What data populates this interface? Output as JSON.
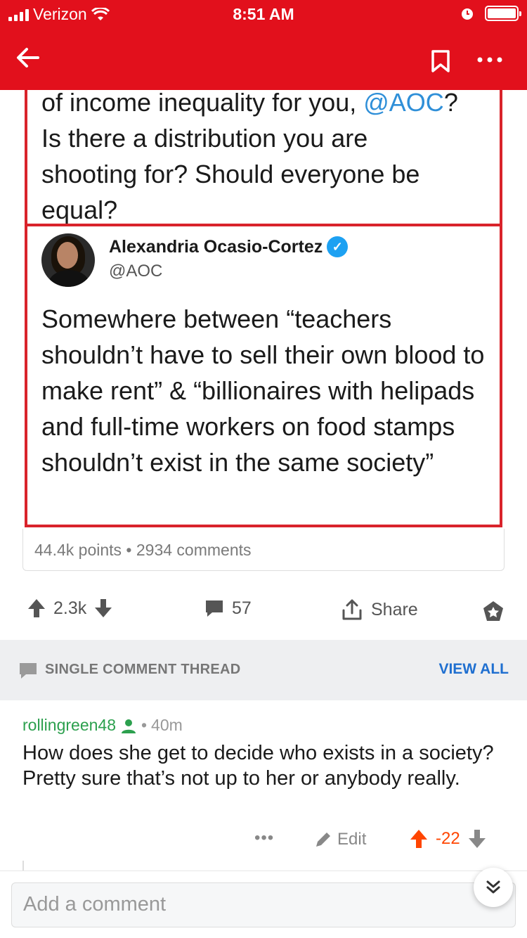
{
  "status_bar": {
    "carrier": "Verizon",
    "time": "8:51 AM"
  },
  "colors": {
    "header": "#e2101c",
    "link": "#2f8fd8",
    "author": "#2ca04e",
    "score": "#ff4500",
    "view_all": "#1f6fd0"
  },
  "post": {
    "tweet_top_lines": [
      "of income inequality for you, ",
      "@AOC",
      "?",
      "Is there a distribution you are",
      "shooting for? Should everyone be",
      "equal?"
    ],
    "tweet_name": "Alexandria Ocasio-Cortez",
    "tweet_handle": "@AOC",
    "tweet_body": "Somewhere between “teachers shouldn’t have to sell their own blood to make rent” & “billionaires with helipads and full-time workers on food stamps shouldn’t exist in the same society”",
    "points_line": "44.4k points • 2934 comments"
  },
  "actions": {
    "score": "2.3k",
    "comments": "57",
    "share": "Share"
  },
  "thread": {
    "label": "SINGLE COMMENT THREAD",
    "view_all": "VIEW ALL"
  },
  "comment": {
    "author": "rollingreen48",
    "age": "40m",
    "separator": "•",
    "body": "How does she get to decide who exists in a society? Pretty sure that’s not up to her or anybody really.",
    "more": "•••",
    "edit": "Edit",
    "score": "-22"
  },
  "compose": {
    "placeholder": "Add a comment"
  }
}
